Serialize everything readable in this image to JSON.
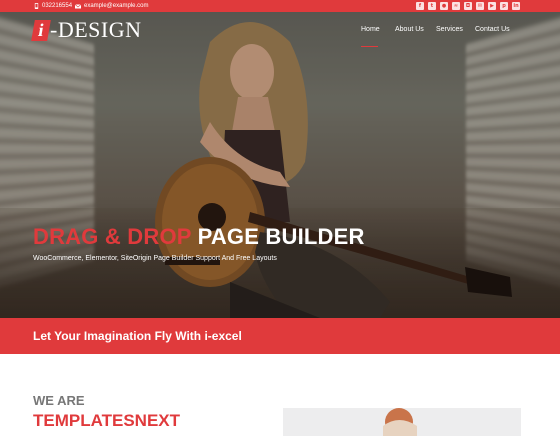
{
  "topbar": {
    "phone": "032216554",
    "email": "example@example.com",
    "social_icons": [
      "facebook-icon",
      "twitter-icon",
      "flickr-icon",
      "rss-icon",
      "instagram-icon",
      "email-icon",
      "youtube-icon",
      "pinterest-icon",
      "linkedin-icon"
    ]
  },
  "logo": {
    "mark": "i",
    "text": "-DESIGN"
  },
  "nav": {
    "items": [
      "Home",
      "About Us",
      "Services",
      "Contact Us"
    ],
    "active": "Home"
  },
  "hero": {
    "headline_red": "DRAG & DROP",
    "headline_white": "PAGE BUILDER",
    "subline": "WooCommerce, Elementor, SiteOrigin Page Builder Support And Free Layouts"
  },
  "band": {
    "text": "Let Your Imagination Fly With i-excel"
  },
  "about": {
    "eyebrow": "WE ARE",
    "title": "TEMPLATESNEXT"
  },
  "colors": {
    "accent": "#e03a3c",
    "muted_heading": "#777777",
    "preview_bg": "#ededee"
  }
}
